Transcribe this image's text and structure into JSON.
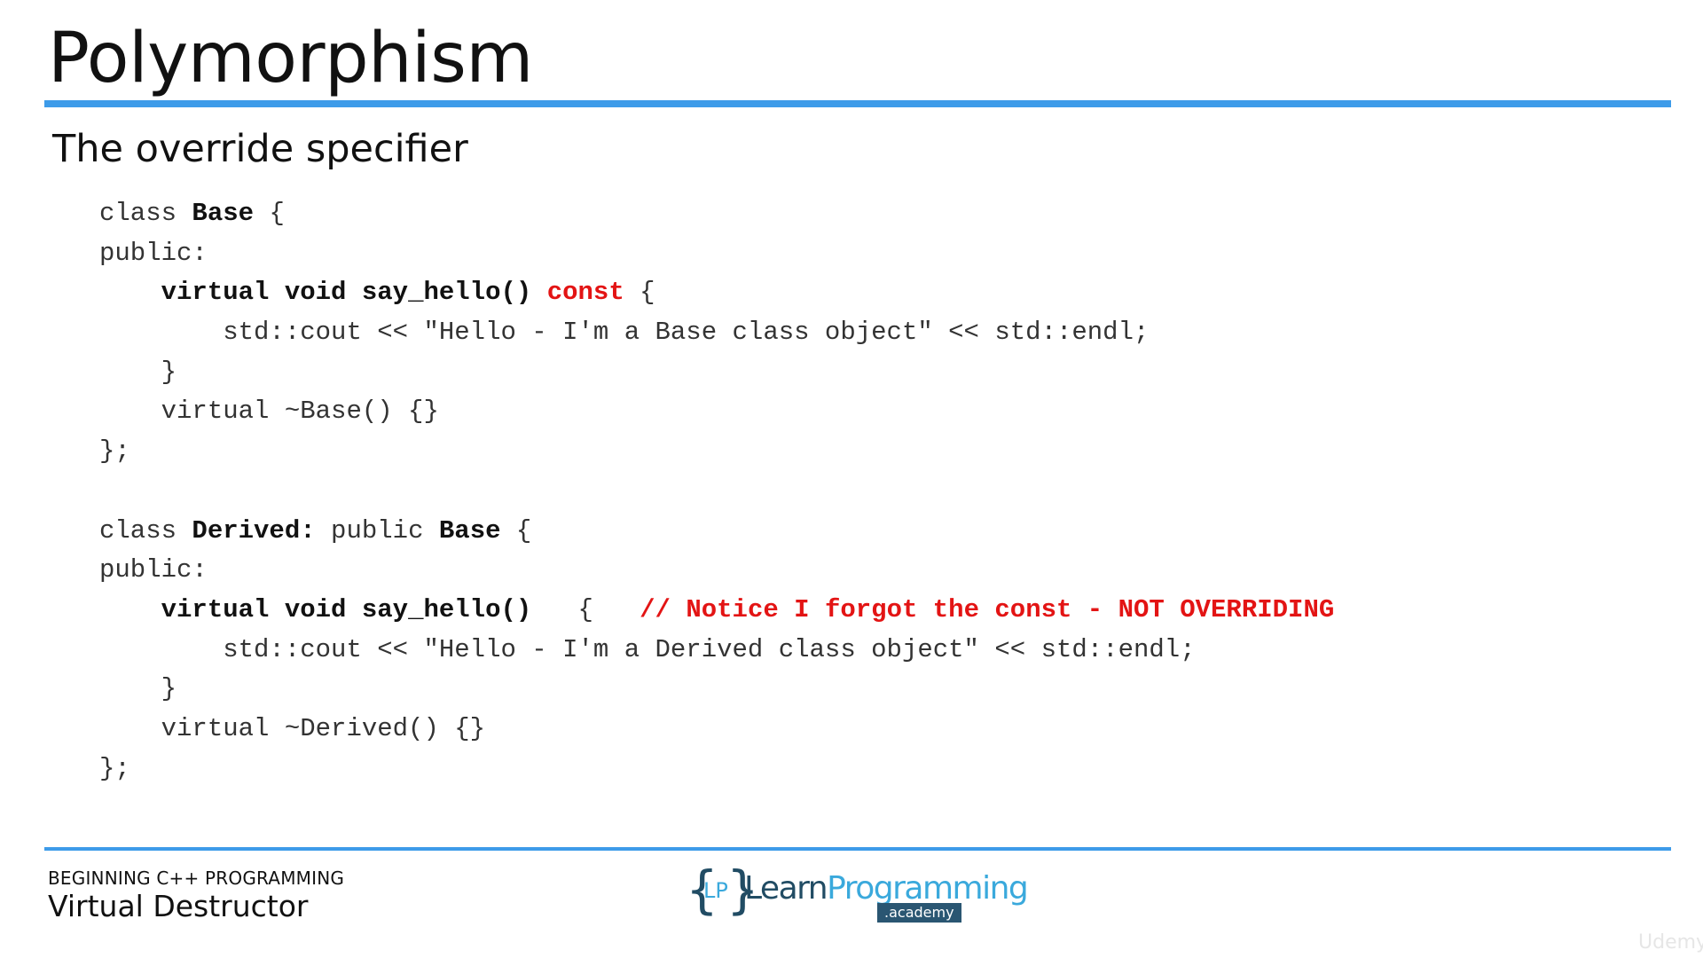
{
  "slide": {
    "title": "Polymorphism",
    "subtitle": "The override specifier"
  },
  "code": {
    "lines": [
      [
        {
          "text": "class ",
          "style": "plain"
        },
        {
          "text": "Base",
          "style": "bold"
        },
        {
          "text": " {",
          "style": "plain"
        }
      ],
      [
        {
          "text": "public:",
          "style": "plain"
        }
      ],
      [
        {
          "text": "    ",
          "style": "plain"
        },
        {
          "text": "virtual void say_hello()",
          "style": "bold"
        },
        {
          "text": " ",
          "style": "plain"
        },
        {
          "text": "const",
          "style": "red"
        },
        {
          "text": " {",
          "style": "plain"
        }
      ],
      [
        {
          "text": "        std::cout << \"Hello - I'm a Base class object\" << std::endl;",
          "style": "plain"
        }
      ],
      [
        {
          "text": "    }",
          "style": "plain"
        }
      ],
      [
        {
          "text": "    virtual ~Base() {}",
          "style": "plain"
        }
      ],
      [
        {
          "text": "};",
          "style": "plain"
        }
      ],
      [
        {
          "text": "",
          "style": "plain"
        }
      ],
      [
        {
          "text": "class ",
          "style": "plain"
        },
        {
          "text": "Derived:",
          "style": "bold"
        },
        {
          "text": " public ",
          "style": "plain"
        },
        {
          "text": "Base",
          "style": "bold"
        },
        {
          "text": " {",
          "style": "plain"
        }
      ],
      [
        {
          "text": "public:",
          "style": "plain"
        }
      ],
      [
        {
          "text": "    ",
          "style": "plain"
        },
        {
          "text": "virtual void say_hello()",
          "style": "bold"
        },
        {
          "text": "   {   ",
          "style": "plain"
        },
        {
          "text": "// Notice I forgot the const - NOT OVERRIDING",
          "style": "red"
        }
      ],
      [
        {
          "text": "        std::cout << \"Hello - I'm a Derived class object\" << std::endl;",
          "style": "plain"
        }
      ],
      [
        {
          "text": "    }",
          "style": "plain"
        }
      ],
      [
        {
          "text": "    virtual ~Derived() {}",
          "style": "plain"
        }
      ],
      [
        {
          "text": "};",
          "style": "plain"
        }
      ]
    ]
  },
  "footer": {
    "course": "BEGINNING C++ PROGRAMMING",
    "lecture": "Virtual Destructor"
  },
  "logo": {
    "brace_left": "{",
    "lp": "LP",
    "brace_right": "}",
    "learn": "Learn",
    "programming": "Programming",
    "academy": ".academy"
  },
  "watermark": "Udemy",
  "colors": {
    "accent": "#3d9be9",
    "highlight_red": "#e31414",
    "logo_dark": "#214c64",
    "logo_light": "#3aa9dc"
  }
}
